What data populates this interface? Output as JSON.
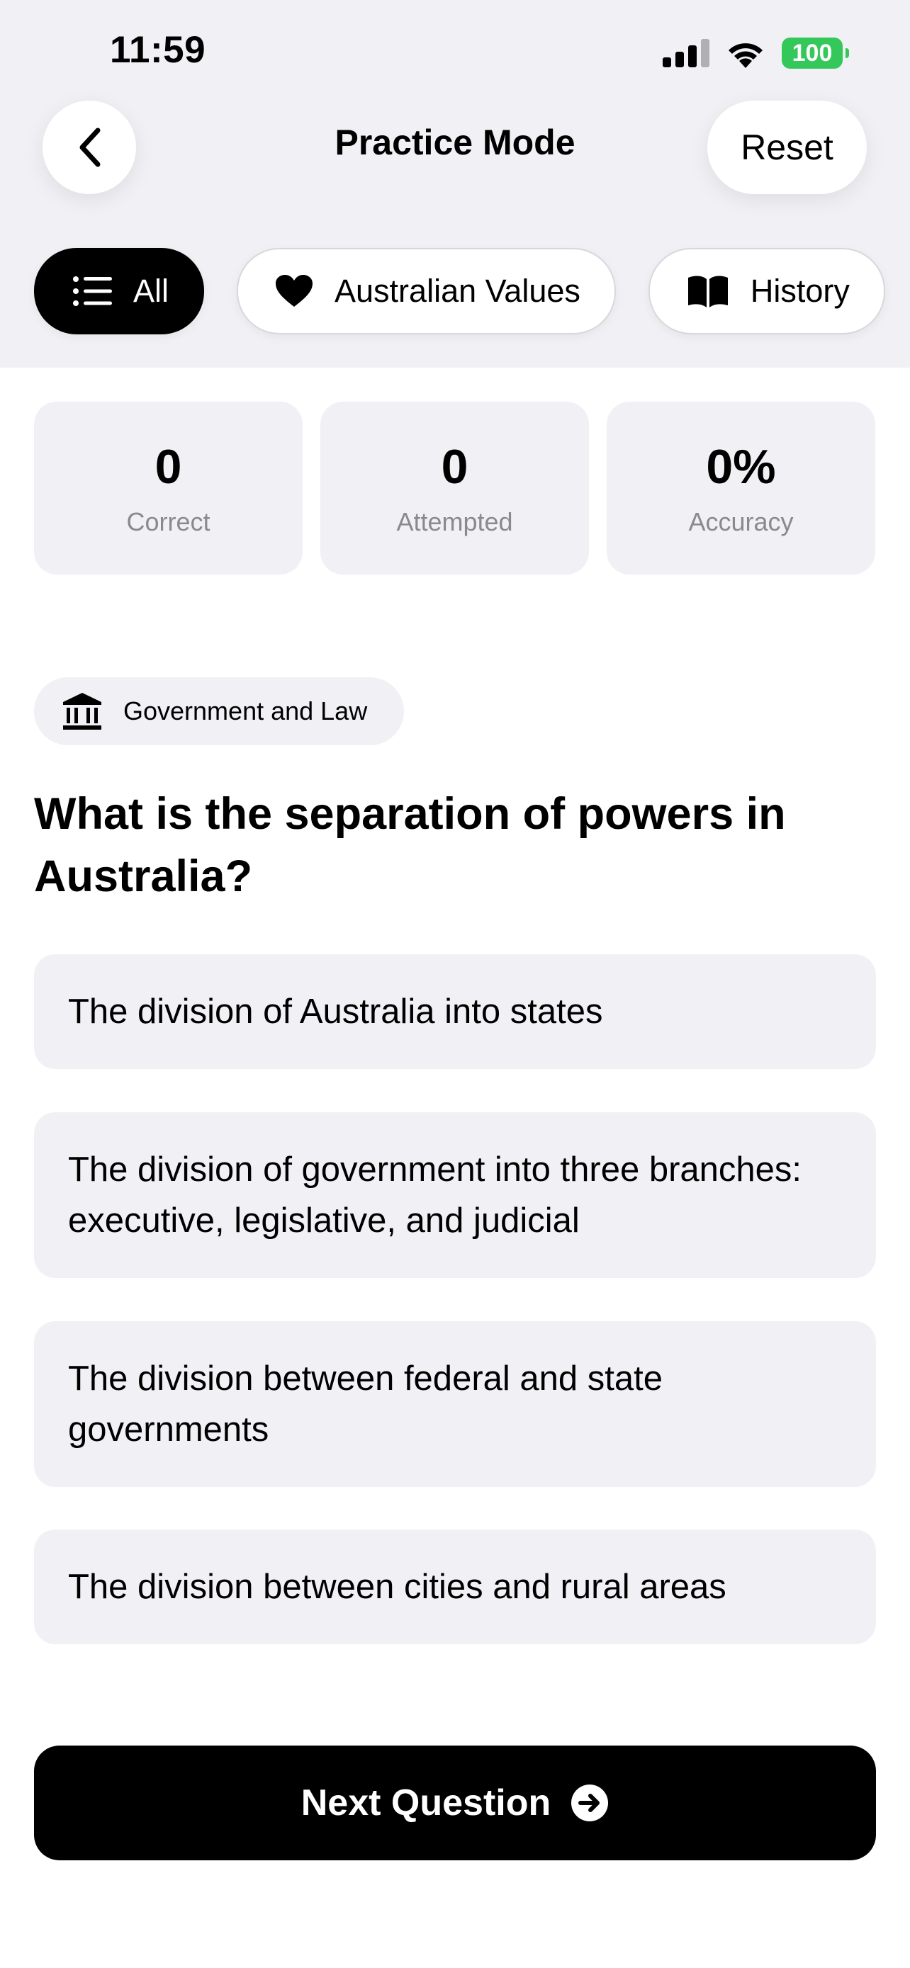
{
  "status_bar": {
    "time": "11:59",
    "battery": "100",
    "battery_color": "#34c759"
  },
  "header": {
    "title": "Practice Mode",
    "reset_label": "Reset",
    "back_icon": "chevron-left-icon"
  },
  "filters": [
    {
      "label": "All",
      "icon": "list-icon",
      "active": true
    },
    {
      "label": "Australian Values",
      "icon": "heart-icon",
      "active": false
    },
    {
      "label": "History",
      "icon": "book-icon",
      "active": false
    }
  ],
  "stats": [
    {
      "value": "0",
      "label": "Correct"
    },
    {
      "value": "0",
      "label": "Attempted"
    },
    {
      "value": "0%",
      "label": "Accuracy"
    }
  ],
  "category": {
    "label": "Government and Law",
    "icon": "bank-icon"
  },
  "question": "What is the separation of powers in Australia?",
  "options": [
    "The division of Australia into states",
    "The division of government into three branches: executive, legislative, and judicial",
    "The division between federal and state governments",
    "The division between cities and rural areas"
  ],
  "next_button": {
    "label": "Next Question",
    "icon": "arrow-right-circle-icon"
  }
}
